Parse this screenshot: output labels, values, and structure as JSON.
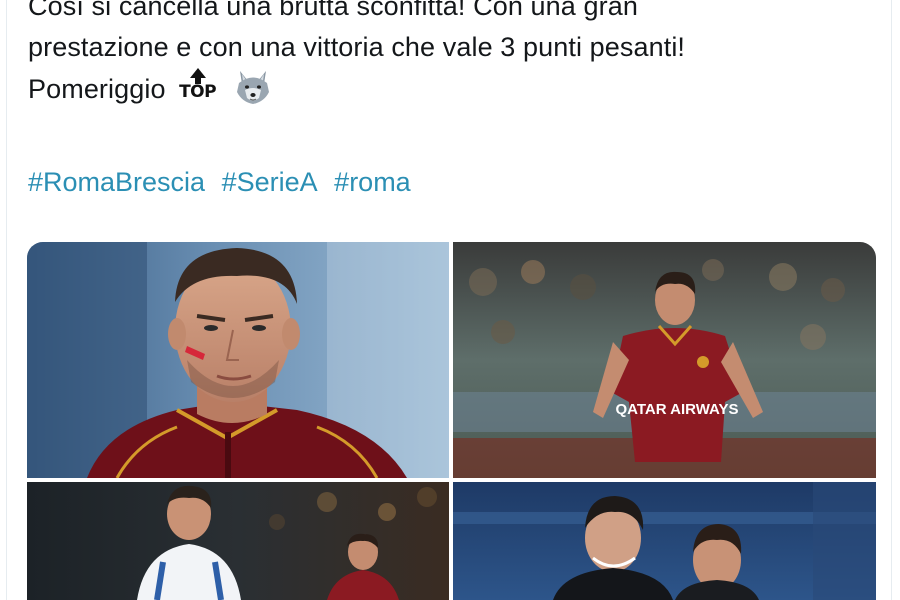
{
  "tweet": {
    "lines": [
      "Così si cancella una brutta sconfitta! Con una gran",
      "prestazione e con una vittoria che vale 3 punti pesanti!",
      "Pomeriggio"
    ],
    "emoji": [
      "top-arrow-icon",
      "wolf-face-icon"
    ],
    "top_emoji_label": "TOP",
    "hashtags": [
      "#RomaBrescia",
      "#SerieA",
      "#roma"
    ]
  },
  "media": {
    "photos": [
      {
        "name": "player-portrait-photo"
      },
      {
        "name": "player-running-photo",
        "shirt_text": "QATAR AIRWAYS"
      },
      {
        "name": "players-match-photo"
      },
      {
        "name": "players-celebrating-photo"
      }
    ]
  },
  "colors": {
    "text": "#14171a",
    "hashtag": "#2b8fb4",
    "roma_red": "#8b1a22"
  }
}
